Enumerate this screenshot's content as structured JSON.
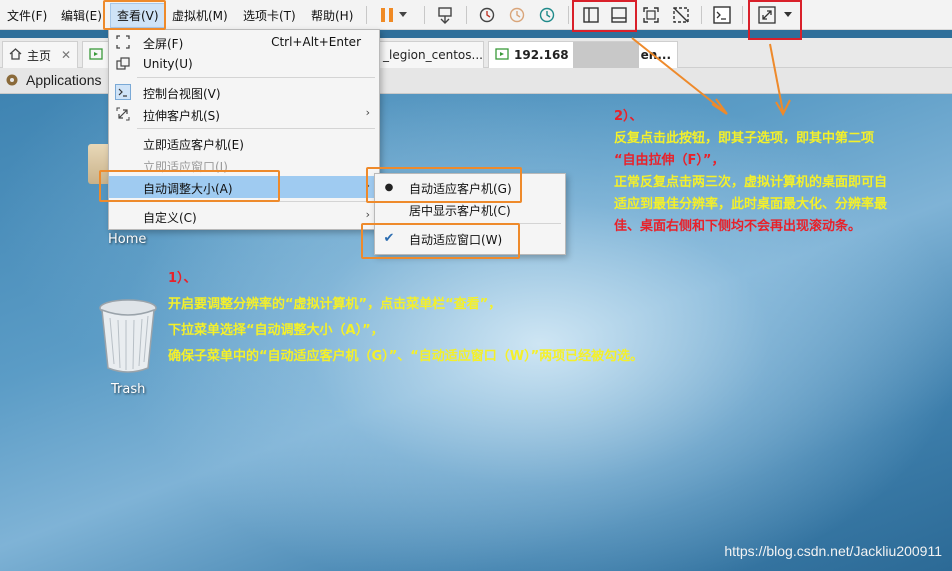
{
  "menubar": {
    "items": [
      {
        "label": "文件(F)"
      },
      {
        "label": "编辑(E)"
      },
      {
        "label": "查看(V)"
      },
      {
        "label": "虚拟机(M)"
      },
      {
        "label": "选项卡(T)"
      },
      {
        "label": "帮助(H)"
      }
    ]
  },
  "tabs": [
    {
      "label": "主页"
    },
    {
      "label": "_legion_centos..."
    },
    {
      "label": "192.168"
    },
    {
      "label": "en..."
    }
  ],
  "gnome": {
    "applications": "Applications"
  },
  "view_menu": {
    "items": [
      {
        "label": "全屏(F)",
        "shortcut": "Ctrl+Alt+Enter"
      },
      {
        "label": "Unity(U)"
      },
      {
        "label": "控制台视图(V)"
      },
      {
        "label": "拉伸客户机(S)"
      },
      {
        "label": "立即适应客户机(E)"
      },
      {
        "label": "立即适应窗口(I)"
      },
      {
        "label": "自动调整大小(A)"
      },
      {
        "label": "自定义(C)"
      }
    ]
  },
  "submenu": {
    "items": [
      {
        "label": "自动适应客户机(G)",
        "mark": "●"
      },
      {
        "label": "居中显示客户机(C)",
        "mark": ""
      },
      {
        "label": "自动适应窗口(W)",
        "mark": "✔"
      }
    ]
  },
  "desktop": {
    "home": "Home",
    "trash": "Trash"
  },
  "annotation1": {
    "num": "1）、",
    "lines": [
      "开启要调整分辨率的“虚拟计算机”，点击菜单栏“查看”，",
      "下拉菜单选择“自动调整大小（A）”，",
      "确保子菜单中的“自动适应客户机（G）”、“自动适应窗口（W）”两项已经被勾选。"
    ]
  },
  "annotation2": {
    "num": "2）、",
    "lines": [
      "反复点击此按钮，即其子选项，即其中第二项",
      "“自由拉伸（F）”，",
      "正常反复点击两三次，虚拟计算机的桌面即可自",
      "适应到最佳分辨率，此时桌面最大化、分辨率最",
      "佳、桌面右侧和下侧均不会再出现滚动条。"
    ]
  },
  "watermark": "https://blog.csdn.net/Jackliu200911",
  "colors": {
    "accent_red": "#d9202a",
    "accent_orange": "#ee8a2b",
    "menu_highlight": "#9fcbf1",
    "pause_orange": "#f08a24"
  }
}
